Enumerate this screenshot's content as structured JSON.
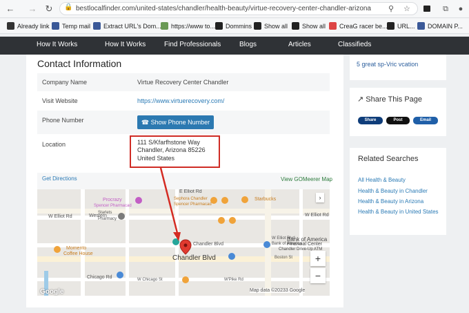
{
  "browser": {
    "url": "bestlocalfinder.com/united-states/chandler/health-beauty/virtue-recovery-center-chandler-arizona",
    "icons": [
      "back-icon",
      "forward-icon",
      "reload-icon",
      "lock-icon",
      "search-icon",
      "star-icon"
    ]
  },
  "bookmarks": [
    {
      "label": "Already link",
      "color": "#333333"
    },
    {
      "label": "Temp mail",
      "color": "#3b5998"
    },
    {
      "label": "Extract URL's Dom...",
      "color": "#3b5998"
    },
    {
      "label": "https://www to...",
      "color": "#6a9955"
    },
    {
      "label": "Dommins",
      "color": "#222222"
    },
    {
      "label": "Show all",
      "color": "#222222"
    },
    {
      "label": "Show all",
      "color": "#222222"
    },
    {
      "label": "CreaG racer be...",
      "color": "#d44"
    },
    {
      "label": "URL...",
      "color": "#222"
    },
    {
      "label": "DOMAIN P...",
      "color": "#3b5998"
    }
  ],
  "sitenav": [
    "How It Works",
    "How It Works",
    "Find Professionals",
    "Blogs",
    "Articles",
    "Classifieds"
  ],
  "contact": {
    "heading": "Contact Information",
    "company_label": "Company Name",
    "company_value": "Virtue Recovery Center Chandler",
    "website_label": "Visit Website",
    "website_value": "https://www.virtuerecovery.com/",
    "phone_label": "Phone Number",
    "phone_button": "Show Phone Number",
    "location_label": "Location",
    "address_line1": "111 S/Kfarfhstone Way",
    "address_line2": "Chandler, Arizona 85226",
    "address_line3": "United States",
    "get_directions": "Get Directions",
    "view_map": "View GOMeerer Map"
  },
  "map": {
    "labels": {
      "elliot_w": "W Elliot Rd",
      "elliot_e": "W Elliot Rd",
      "elliot_top": "E Elliot Rd",
      "western": "Western",
      "procrazy": "Procrazy",
      "spencer1": "Spencer Pharmacad",
      "starlets": "Starlets",
      "pharmacy": "Pharmacy",
      "sephora": "Sephora Chandler",
      "spencer2": "Spencer Pharmacad",
      "starbucks": "Starbucks",
      "moments": "Momento",
      "coffee": "Coffee House",
      "chandler_blvd": "Chandler Blvd",
      "chandler_blvd2": "Chandler Blvd",
      "chandler_blvd_big": "Chandler Blvd",
      "chicago": "Chicago Rd",
      "w_chicago": "W Chicago St",
      "boa1": "Bank of America",
      "boa2": "Financial Center",
      "boa3": "Chandler Drive-Up ATM",
      "elliot_blvd": "W Elliot Blvd",
      "boston": "Boston St",
      "pike": "W'Pike Rd",
      "attribution": "Map data ©20233 Google",
      "google": "Google",
      "zoom_in": "+",
      "zoom_out": "−"
    }
  },
  "sidebar": {
    "top_text": "5 great sp-Vric vcation",
    "share_heading": "Share This Page",
    "share_buttons": [
      {
        "label": "Share",
        "color": "#0f3d7a"
      },
      {
        "label": "Post",
        "color": "#111111"
      },
      {
        "label": "Email",
        "color": "#1f5fa8"
      }
    ],
    "related_heading": "Related Searches",
    "related": [
      "All Health & Beauty",
      "Health & Beauty in Chandler",
      "Health & Beauty in Arizona",
      "Health & Beauty in United States"
    ]
  },
  "colors": {
    "accent": "#2c79b1",
    "highlight": "#cf2b24",
    "nav_bg": "#2f3236"
  }
}
